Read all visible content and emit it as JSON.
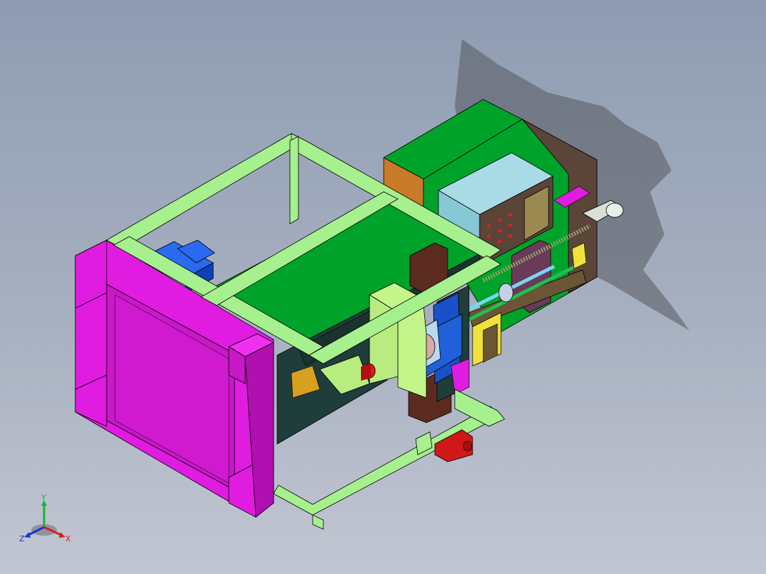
{
  "viewport": {
    "background_top": "#8e9cb2",
    "background_bottom": "#c2c6d2"
  },
  "model": {
    "parts": [
      {
        "id": "base-frame",
        "color": "#a6f08e"
      },
      {
        "id": "fixed-platen",
        "color": "#e01ce0"
      },
      {
        "id": "machine-bed",
        "color": "#00a32a"
      },
      {
        "id": "bed-side-panel",
        "color": "#1f3d3a"
      },
      {
        "id": "motor",
        "color": "#1552e8"
      },
      {
        "id": "control-box",
        "color": "#87c8d6"
      },
      {
        "id": "panel-board",
        "color": "#5b4538"
      },
      {
        "id": "hopper-frame",
        "color": "#c4f58a"
      },
      {
        "id": "heater-nozzle",
        "color": "#e01a1a"
      },
      {
        "id": "guide-rod",
        "color": "#20c050"
      },
      {
        "id": "tie-bar",
        "color": "#7ad4f0"
      },
      {
        "id": "ejector-block",
        "color": "#f0e23a"
      },
      {
        "id": "mold-block",
        "color": "#5b2b20"
      },
      {
        "id": "screw-shaft",
        "color": "#9aa06a"
      },
      {
        "id": "bearing-housing",
        "color": "#d8e0d8"
      }
    ]
  },
  "triad": {
    "x_label": "X",
    "y_label": "Y",
    "z_label": "Z",
    "x_color": "#d42020",
    "y_color": "#20b030",
    "z_color": "#2030d0"
  }
}
